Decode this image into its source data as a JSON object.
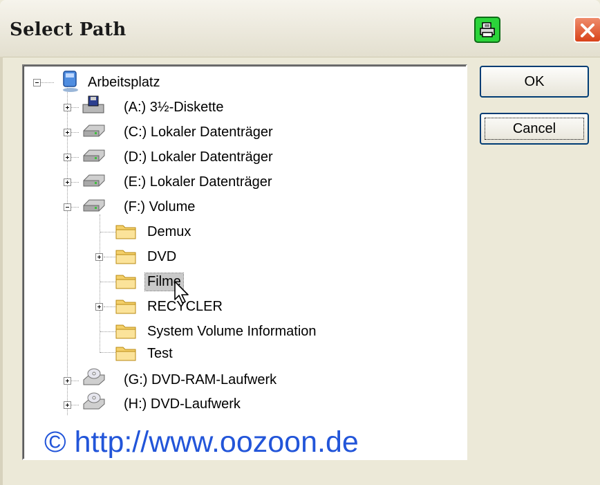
{
  "window": {
    "title": "Select Path"
  },
  "titlebar_icons": {
    "print": "printer-icon",
    "close": "close-icon"
  },
  "buttons": {
    "ok": "OK",
    "cancel": "Cancel"
  },
  "tree": {
    "root": "Arbeitsplatz",
    "drives": [
      {
        "label": "(A:)  3½-Diskette",
        "icon": "floppy-drive-icon",
        "state": "collapsed"
      },
      {
        "label": "(C:)  Lokaler Datenträger",
        "icon": "hard-drive-icon",
        "state": "collapsed"
      },
      {
        "label": "(D:)  Lokaler Datenträger",
        "icon": "hard-drive-icon",
        "state": "collapsed"
      },
      {
        "label": "(E:)  Lokaler Datenträger",
        "icon": "hard-drive-icon",
        "state": "collapsed"
      },
      {
        "label": "(F:)  Volume",
        "icon": "hard-drive-icon",
        "state": "expanded"
      },
      {
        "label": "(G:)  DVD-RAM-Laufwerk",
        "icon": "dvd-drive-icon",
        "state": "collapsed"
      },
      {
        "label": "(H:)  DVD-Laufwerk",
        "icon": "dvd-drive-icon",
        "state": "collapsed"
      }
    ],
    "f_children": [
      {
        "label": "Demux",
        "expandable": false
      },
      {
        "label": "DVD",
        "expandable": true
      },
      {
        "label": "Filme",
        "expandable": false,
        "selected": true
      },
      {
        "label": "RECYCLER",
        "expandable": true
      },
      {
        "label": "System Volume Information",
        "expandable": false
      },
      {
        "label": "Test",
        "expandable": false
      }
    ]
  },
  "watermark": "© http://www.oozoon.de",
  "colors": {
    "watermark": "#2255d9",
    "selection": "#c9c9c9",
    "button_border": "#003c74"
  }
}
